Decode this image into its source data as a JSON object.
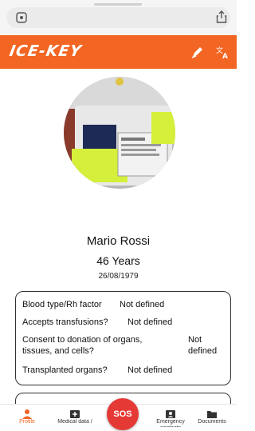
{
  "header": {
    "logo_text": "ICE-KEY",
    "accent_color": "#f26522",
    "icons": [
      "edit-icon",
      "translate-icon"
    ]
  },
  "profile": {
    "name": "Mario Rossi",
    "age": "46 Years",
    "birth_date": "26/08/1979"
  },
  "medical_info": {
    "blood_type_label": "Blood type/Rh factor",
    "blood_type_value": "Not defined",
    "transfusions_label": "Accepts transfusions?",
    "transfusions_value": "Not defined",
    "organ_donation_label_line1": "Consent to donation of organs,",
    "organ_donation_label_line2": "tissues, and cells?",
    "organ_donation_value_line1": "Not",
    "organ_donation_value_line2": "defined",
    "transplanted_label": "Transplanted organs?",
    "transplanted_value": "Not defined"
  },
  "bottom_nav": {
    "profile": "Profile",
    "medical": "Medical data /",
    "sos": "SOS",
    "emergency": "Emergency contacts",
    "documents": "Documents",
    "sos_color": "#e53935"
  }
}
